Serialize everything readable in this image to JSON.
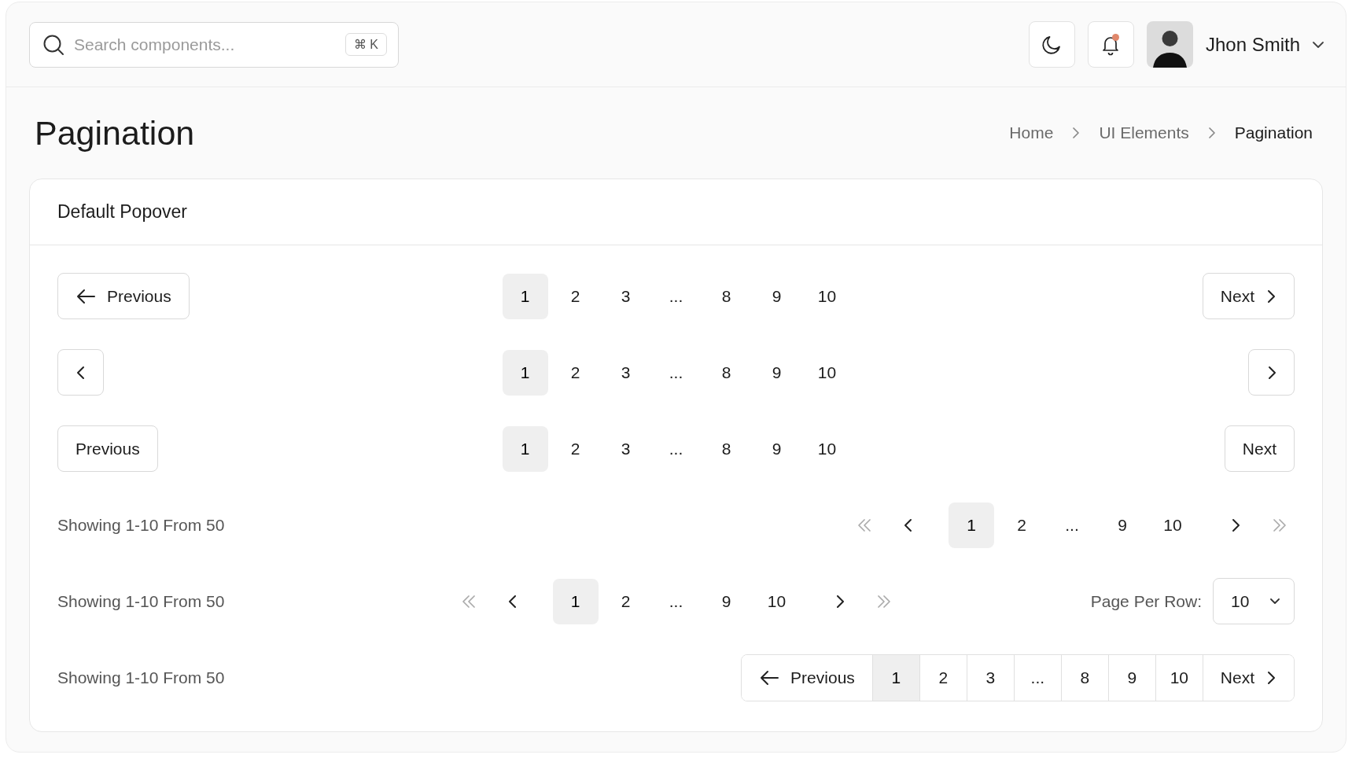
{
  "search": {
    "placeholder": "Search components...",
    "shortcut": "⌘ K"
  },
  "notifications": {
    "unread": true
  },
  "user": {
    "name": "Jhon Smith"
  },
  "page_title": "Pagination",
  "breadcrumb": [
    {
      "label": "Home",
      "current": false
    },
    {
      "label": "UI Elements",
      "current": false
    },
    {
      "label": "Pagination",
      "current": true
    }
  ],
  "card": {
    "title": "Default Popover",
    "rows": [
      {
        "kind": "arrow-text",
        "prev": "Previous",
        "next": "Next",
        "pages": [
          {
            "label": "1",
            "selected": true
          },
          {
            "label": "2",
            "selected": false
          },
          {
            "label": "3",
            "selected": false
          },
          {
            "label": "..."
          },
          {
            "label": "8",
            "selected": false
          },
          {
            "label": "9",
            "selected": false
          },
          {
            "label": "10",
            "selected": false
          }
        ]
      },
      {
        "kind": "icon-only",
        "pages": [
          {
            "label": "1",
            "selected": true
          },
          {
            "label": "2",
            "selected": false
          },
          {
            "label": "3",
            "selected": false
          },
          {
            "label": "..."
          },
          {
            "label": "8",
            "selected": false
          },
          {
            "label": "9",
            "selected": false
          },
          {
            "label": "10",
            "selected": false
          }
        ]
      },
      {
        "kind": "text",
        "prev": "Previous",
        "next": "Next",
        "pages": [
          {
            "label": "1",
            "selected": true
          },
          {
            "label": "2",
            "selected": false
          },
          {
            "label": "3",
            "selected": false
          },
          {
            "label": "..."
          },
          {
            "label": "8",
            "selected": false
          },
          {
            "label": "9",
            "selected": false
          },
          {
            "label": "10",
            "selected": false
          }
        ]
      },
      {
        "kind": "info-right",
        "info": "Showing 1-10 From 50",
        "pages": [
          {
            "label": "1",
            "selected": true
          },
          {
            "label": "2",
            "selected": false
          },
          {
            "label": "..."
          },
          {
            "label": "9",
            "selected": false
          },
          {
            "label": "10",
            "selected": false
          }
        ]
      },
      {
        "kind": "info-center",
        "info": "Showing 1-10 From 50",
        "per_row": {
          "label": "Page Per Row:",
          "value": "10"
        },
        "pages": [
          {
            "label": "1",
            "selected": true
          },
          {
            "label": "2",
            "selected": false
          },
          {
            "label": "..."
          },
          {
            "label": "9",
            "selected": false
          },
          {
            "label": "10",
            "selected": false
          }
        ]
      },
      {
        "kind": "grouped",
        "info": "Showing 1-10 From 50",
        "prev": "Previous",
        "next": "Next",
        "pages": [
          {
            "label": "1",
            "selected": true
          },
          {
            "label": "2",
            "selected": false
          },
          {
            "label": "3",
            "selected": false
          },
          {
            "label": "..."
          },
          {
            "label": "8",
            "selected": false
          },
          {
            "label": "9",
            "selected": false
          },
          {
            "label": "10",
            "selected": false
          }
        ]
      }
    ]
  }
}
